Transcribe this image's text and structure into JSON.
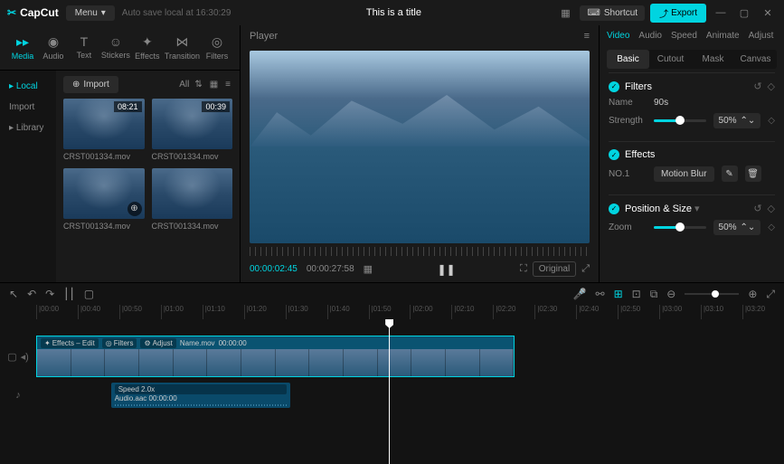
{
  "titlebar": {
    "logo": "CapCut",
    "menu": "Menu",
    "autosave": "Auto save local at 16:30:29",
    "title": "This is a title",
    "shortcut": "Shortcut",
    "export": "Export"
  },
  "mediaTabs": [
    {
      "label": "Media",
      "active": true
    },
    {
      "label": "Audio",
      "active": false
    },
    {
      "label": "Text",
      "active": false
    },
    {
      "label": "Stickers",
      "active": false
    },
    {
      "label": "Effects",
      "active": false
    },
    {
      "label": "Transition",
      "active": false
    },
    {
      "label": "Filters",
      "active": false
    }
  ],
  "mediaSide": [
    {
      "label": "Local",
      "active": true
    },
    {
      "label": "Import",
      "active": false
    },
    {
      "label": "Library",
      "active": false
    }
  ],
  "importBtn": "Import",
  "viewAll": "All",
  "clips": [
    {
      "duration": "08:21",
      "name": "CRST001334.mov"
    },
    {
      "duration": "00:39",
      "name": "CRST001334.mov"
    },
    {
      "duration": "",
      "name": "CRST001334.mov"
    },
    {
      "duration": "",
      "name": "CRST001334.mov"
    }
  ],
  "player": {
    "title": "Player",
    "currentTime": "00:00:02:45",
    "duration": "00:00:27:58",
    "original": "Original"
  },
  "propsTabs": [
    {
      "label": "Video",
      "active": true
    },
    {
      "label": "Audio",
      "active": false
    },
    {
      "label": "Speed",
      "active": false
    },
    {
      "label": "Animate",
      "active": false
    },
    {
      "label": "Adjust",
      "active": false
    }
  ],
  "subTabs": [
    {
      "label": "Basic",
      "active": true
    },
    {
      "label": "Cutout",
      "active": false
    },
    {
      "label": "Mask",
      "active": false
    },
    {
      "label": "Canvas",
      "active": false
    }
  ],
  "filters": {
    "title": "Filters",
    "nameLabel": "Name",
    "nameValue": "90s",
    "strengthLabel": "Strength",
    "strengthValue": "50%",
    "strengthPct": 50
  },
  "effects": {
    "title": "Effects",
    "numLabel": "NO.1",
    "name": "Motion Blur"
  },
  "position": {
    "title": "Position & Size",
    "zoomLabel": "Zoom",
    "zoomValue": "50%",
    "zoomPct": 50
  },
  "timeline": {
    "ticks": [
      "|00:00",
      "|00:40",
      "|00:50",
      "|01:00",
      "|01:10",
      "|01:20",
      "|01:30",
      "|01:40",
      "|01:50",
      "|02:00",
      "|02:10",
      "|02:20",
      "|02:30",
      "|02:40",
      "|02:50",
      "|03:00",
      "|03:10",
      "|03:20"
    ],
    "clipBadges": {
      "effects": "Effects – Edit",
      "filters": "Filters",
      "adjust": "Adjust",
      "name": "Name.mov",
      "time": "00:00:00"
    },
    "audio": {
      "speed": "Speed 2.0x",
      "name": "Audio.aac",
      "time": "00:00:00"
    }
  }
}
